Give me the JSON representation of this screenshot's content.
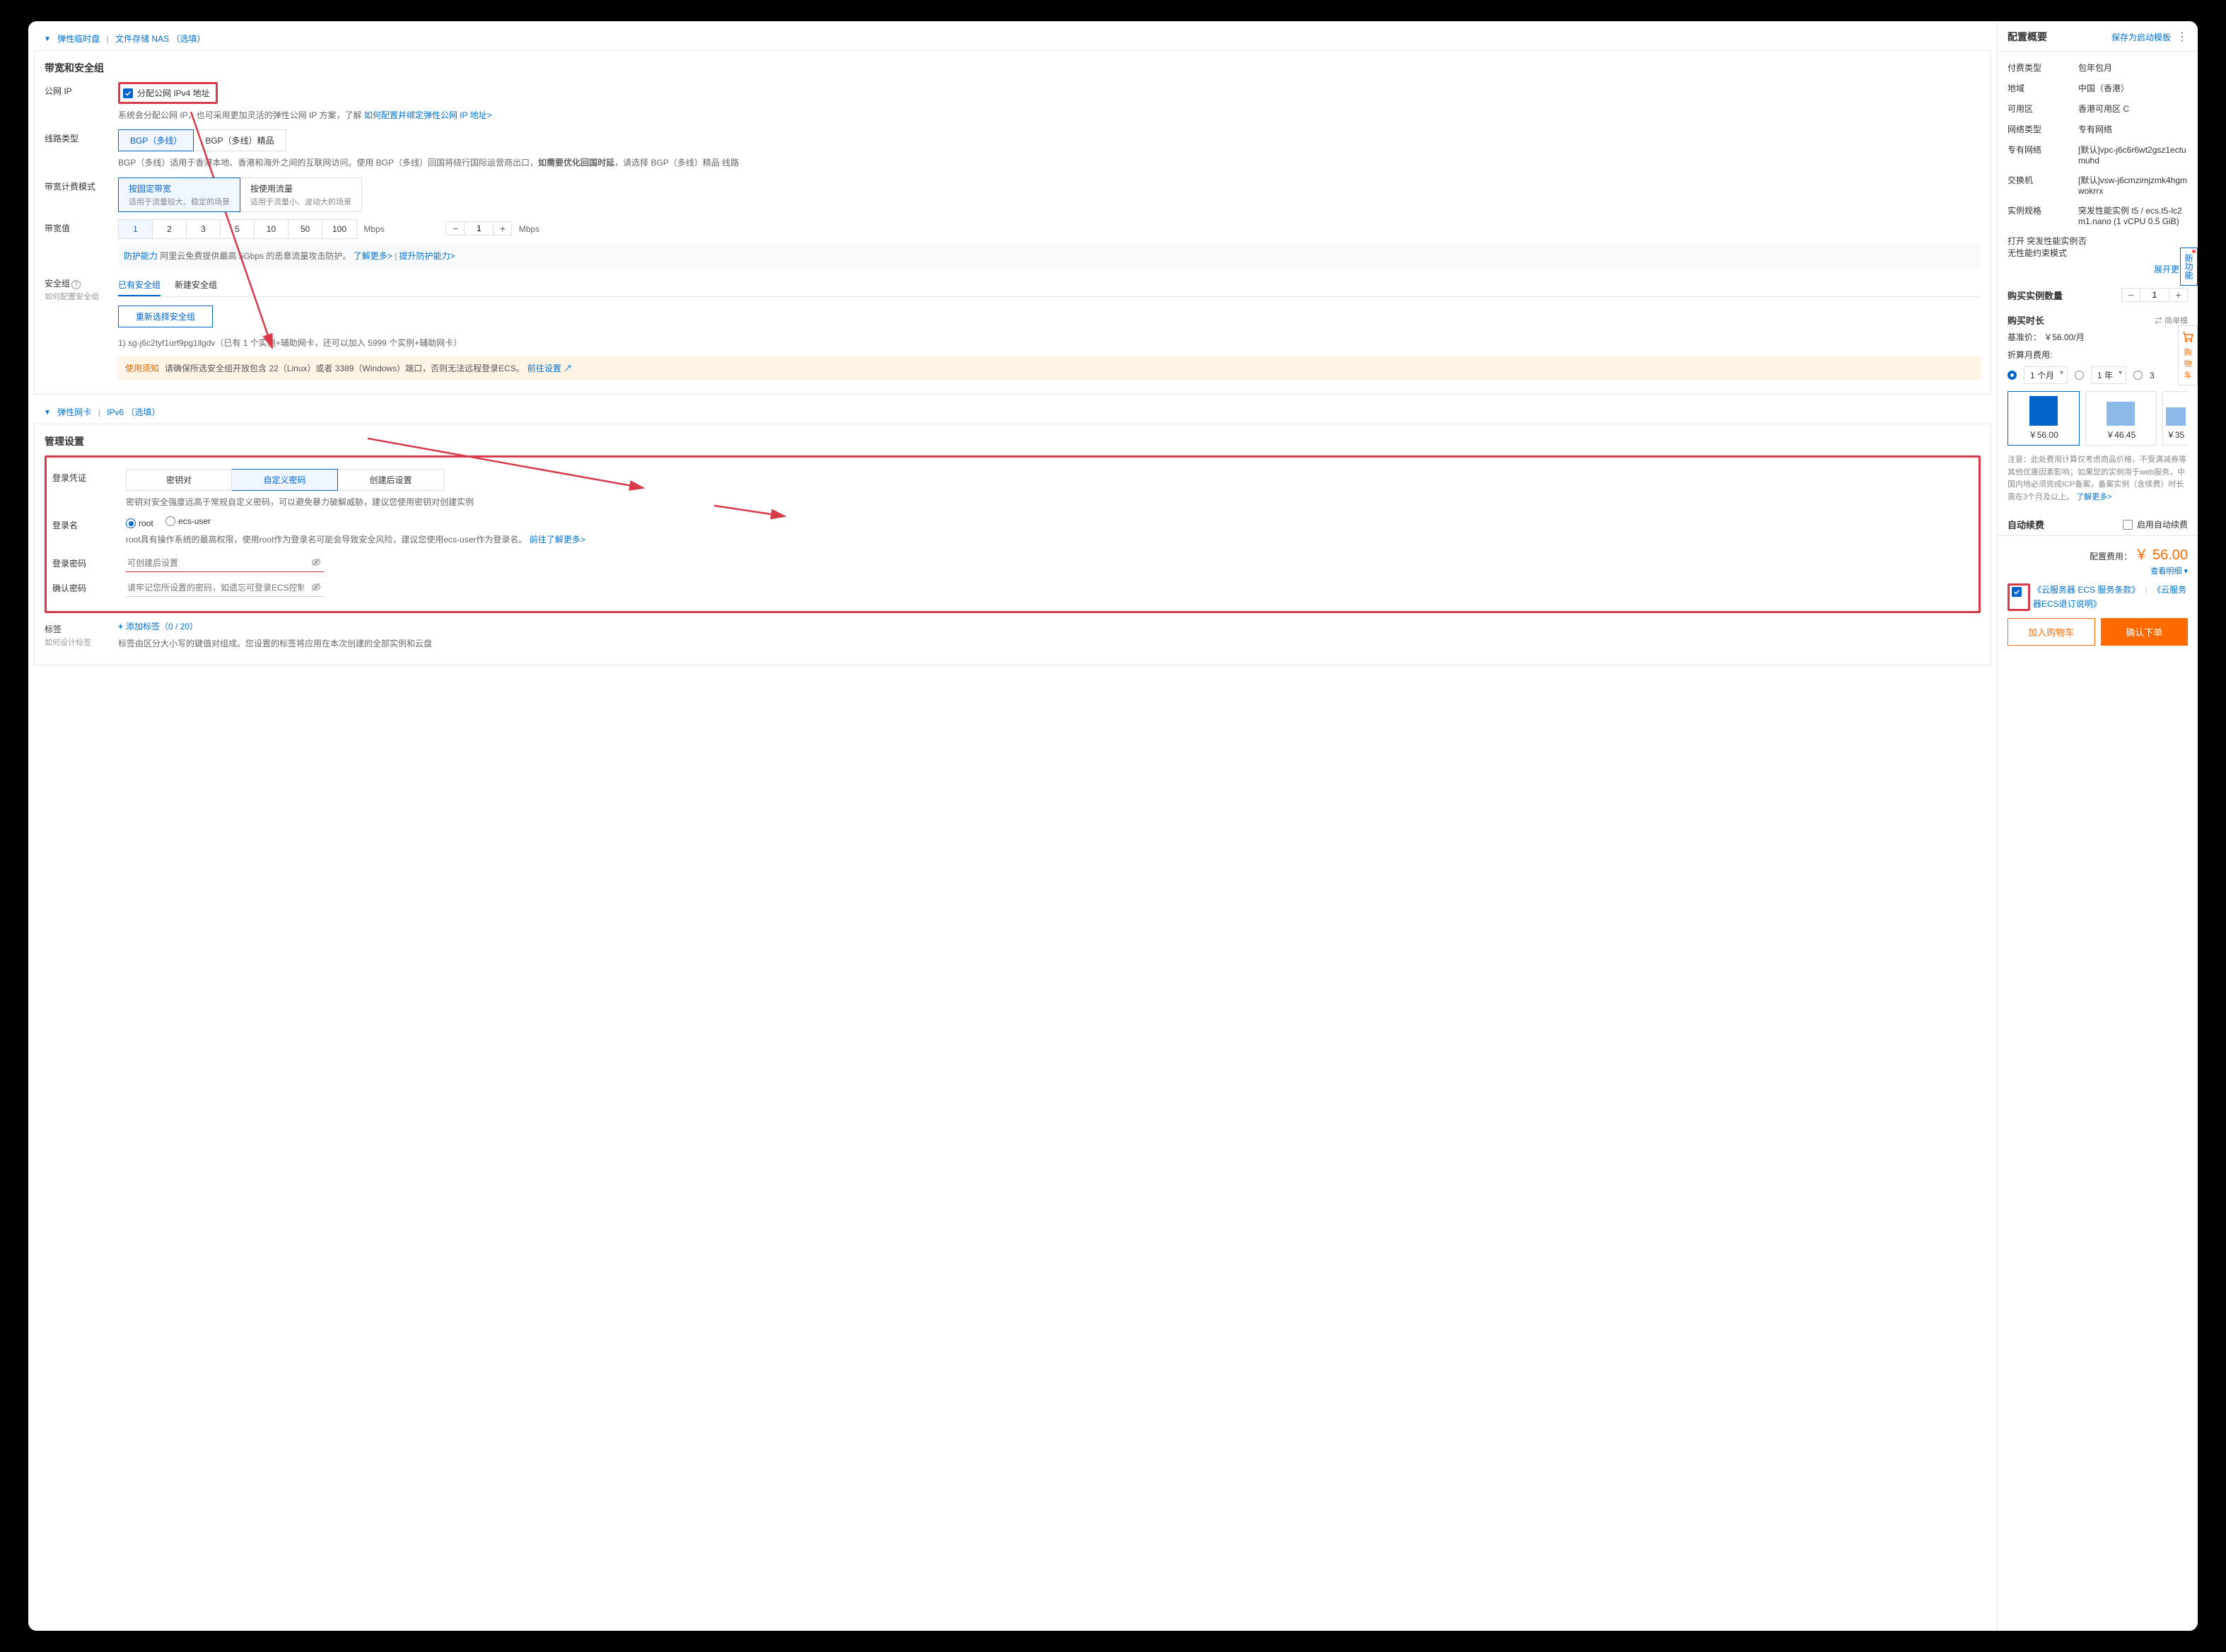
{
  "expandos": {
    "disk_nas": {
      "label": "弹性临时盘",
      "extra_label": "文件存储 NAS",
      "suffix": "（选填）"
    },
    "eni_ipv6": {
      "label": "弹性网卡",
      "extra_label": "IPv6",
      "suffix": "（选填）"
    }
  },
  "network": {
    "title": "带宽和安全组",
    "public_ip": {
      "label": "公网 IP",
      "checkbox": "分配公网 IPv4 地址",
      "help": "系统会分配公网 IP，也可采用更加灵活的弹性公网 IP 方案，了解 ",
      "help_link": "如何配置并绑定弹性公网 IP 地址>"
    },
    "line_type": {
      "label": "线路类型",
      "options": [
        "BGP（多线）",
        "BGP（多线）精品"
      ],
      "help": "BGP（多线）适用于香港本地、香港和海外之间的互联网访问。使用 BGP（多线）回国将绕行国际运营商出口，",
      "help_bold": "如需要优化回国时延",
      "help_tail": "，请选择 BGP（多线）精品 线路"
    },
    "billing": {
      "label": "带宽计费模式",
      "options": [
        {
          "title": "按固定带宽",
          "sub": "适用于流量较大、稳定的场景"
        },
        {
          "title": "按使用流量",
          "sub": "适用于流量小、波动大的场景"
        }
      ]
    },
    "bandwidth": {
      "label": "带宽值",
      "presets": [
        "1",
        "2",
        "3",
        "5",
        "10",
        "50",
        "100"
      ],
      "unit": "Mbps",
      "value": "1",
      "protect_label": "防护能力",
      "protect_text": " 阿里云免费提供最高 5Gbps 的恶意流量攻击防护。",
      "protect_link1": "了解更多> ",
      "protect_link2": "提升防护能力>"
    },
    "sec_group": {
      "label": "安全组",
      "sub": "如何配置安全组",
      "tabs": [
        "已有安全组",
        "新建安全组"
      ],
      "reselect_btn": "重新选择安全组",
      "current": "1) sg-j6c2tyf1urf9pg1llgdv（已有 1 个实例+辅助网卡，还可以加入 5999 个实例+辅助网卡）",
      "warn_tag": "使用须知",
      "warn_text": "请确保所选安全组开放包含 22（Linux）或者 3389（Windows）端口，否则无法远程登录ECS。",
      "warn_link": "前往设置 ↗"
    }
  },
  "manage": {
    "title": "管理设置",
    "cred": {
      "label": "登录凭证",
      "options": [
        "密钥对",
        "自定义密码",
        "创建后设置"
      ],
      "help": "密钥对安全强度远高于常规自定义密码，可以避免暴力破解威胁，建议您使用密钥对创建实例"
    },
    "login_name": {
      "label": "登录名",
      "options": [
        "root",
        "ecs-user"
      ],
      "help": "root具有操作系统的最高权限，使用root作为登录名可能会导致安全风险，建议您使用ecs-user作为登录名。",
      "help_link": "前往了解更多>"
    },
    "password": {
      "label": "登录密码",
      "placeholder": "可创建后设置"
    },
    "confirm": {
      "label": "确认密码",
      "placeholder": "请牢记您所设置的密码，如遗忘可登录ECS控制台重置密码"
    },
    "tags": {
      "label": "标签",
      "sub": "如何设计标签",
      "add": "添加标签（0 / 20）",
      "help": "标签由区分大小写的键值对组成。您设置的标签将应用在本次创建的全部实例和云盘"
    }
  },
  "side": {
    "title": "配置概要",
    "save_template": "保存为启动模板",
    "kv": [
      {
        "k": "付费类型",
        "v": "包年包月"
      },
      {
        "k": "地域",
        "v": "中国（香港）"
      },
      {
        "k": "可用区",
        "v": "香港可用区 C"
      },
      {
        "k": "网络类型",
        "v": "专有网络"
      },
      {
        "k": "专有网络",
        "v": "[默认]vpc-j6c6r6wt2gsz1ectumuhd"
      },
      {
        "k": "交换机",
        "v": "[默认]vsw-j6cmzimjzmk4hgmwokrrx"
      },
      {
        "k": "实例规格",
        "v": "突发性能实例 t5 / ecs.t5-lc2m1.nano (1 vCPU 0.5 GiB)"
      },
      {
        "k": "打开 突发性能实例 无性能约束模式",
        "v": "否"
      }
    ],
    "expand": "展开更多",
    "qty_title": "购买实例数量",
    "qty": "1",
    "duration_title": "购买时长",
    "simple_mode": "简单模",
    "base_price_label": "基准价：",
    "base_price": "￥56.00/月",
    "discount_label": "折算月费用:",
    "durations": [
      "1 个月",
      "1 年",
      "3"
    ],
    "prices": [
      "￥56.00",
      "￥46.45",
      "￥35"
    ],
    "note": "注意：此处费用计算仅考虑商品价格，不受满减券等其他优惠因素影响；如果您的实例用于web服务，中国内地必须完成ICP备案，备案实例（含续费）时长需在3个月及以上。",
    "note_link": "了解更多>",
    "auto_renew_title": "自动续费",
    "auto_renew_cb": "启用自动续费",
    "total_label": "配置费用：",
    "total_price": "￥ 56.00",
    "detail": "查看明细",
    "agree_link1": "《云服务器 ECS 服务条款》",
    "agree_sep": "|",
    "agree_link2": "《云服务器ECS退订说明》",
    "btn_cart": "加入购物车",
    "btn_confirm": "确认下单"
  },
  "float": {
    "new_features": "新功能",
    "cart": "购物车"
  }
}
